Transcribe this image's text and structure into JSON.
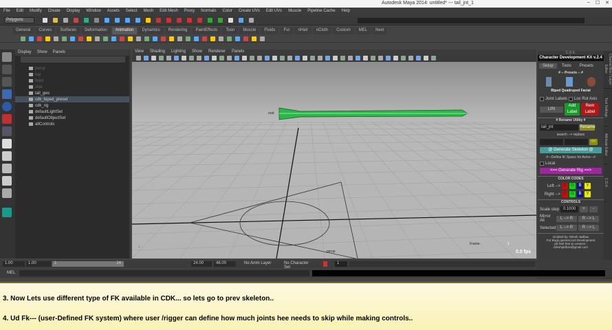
{
  "window": {
    "title": "Autodesk Maya 2014: untitled*   ---   tail_jnt_1"
  },
  "menu": [
    "File",
    "Edit",
    "Modify",
    "Create",
    "Display",
    "Window",
    "Assets",
    "Select",
    "Mesh",
    "Edit Mesh",
    "Proxy",
    "Normals",
    "Color",
    "Create UVs",
    "Edit UVs",
    "Muscle",
    "Pipeline Cache",
    "Help"
  ],
  "status": {
    "mode": "Polygons"
  },
  "shelf_tabs": [
    "General",
    "Curves",
    "Surfaces",
    "Deformation",
    "Animation",
    "Dynamics",
    "Rendering",
    "PaintEffects",
    "Toon",
    "Muscle",
    "Fluids",
    "Fur",
    "nHair",
    "nCloth",
    "Custom",
    "MEL",
    "Next"
  ],
  "shelf_active": "Animation",
  "outliner": {
    "menu": [
      "Display",
      "Show",
      "Panels"
    ],
    "items": [
      {
        "label": "persp",
        "dim": true
      },
      {
        "label": "top",
        "dim": true
      },
      {
        "label": "front",
        "dim": true
      },
      {
        "label": "side",
        "dim": true
      },
      {
        "label": "tail_geo"
      },
      {
        "label": "cdk_biped_preset",
        "selected": true
      },
      {
        "label": "cdk_rig"
      },
      {
        "label": "defaultLightSet"
      },
      {
        "label": "defaultObjectSet"
      },
      {
        "label": "allControls"
      }
    ]
  },
  "viewport": {
    "menu": [
      "View",
      "Shading",
      "Lighting",
      "Show",
      "Renderer",
      "Panels"
    ],
    "camera_label": "persp",
    "frame_label": "Frame:",
    "frame_value": "1",
    "fps": "0.0 fps",
    "joint_label": "root"
  },
  "cdk": {
    "window_title": "C.D.K.",
    "title": "Character Development Kit v.2.4",
    "tabs": [
      "Setup",
      "Tools",
      "Presets"
    ],
    "presets_header": "# -- Presets -- #",
    "preset_labels": "Biped Quadruped Facial",
    "joint_labels": "Joint Labels",
    "loc_rot_axis": "Loc Rot Axis",
    "side_select": "LtRt",
    "add_label": "Add Label",
    "rem_label": "Rem Label",
    "rename_header": "# Rename Utility #",
    "rename_value": "tail_jnt",
    "rename_btn": "Rename",
    "search_replace": "search --> replace",
    "swap_btn": "<<",
    "generate_skeleton": "@ Generate Skeleton @",
    "ik_space": "#---Define IK Space for Arms---#",
    "local": "Local",
    "generate_rig": "<== Generate Rig ==>",
    "color_codes": "COLOR CODES",
    "left": "Left -->",
    "right": "Right -->",
    "colors": [
      "R",
      "G",
      "B",
      "Y"
    ],
    "color_hex": [
      "#e00000",
      "#18d018",
      "#101090",
      "#e8e800"
    ],
    "controls": "CONTROLS",
    "scale_step": "Scale step",
    "scale_value": "0.1000",
    "plus": "+",
    "minus": "-",
    "mirror_all": "Mirror All",
    "selected": "Selected",
    "l_to_r": "L --> R",
    "r_to_l": "R --> L",
    "credits": [
      "scripted by: Nilesh Jadhav",
      "For Bugs,queries,tool Development",
      "plz feel free  to connect :",
      "nileshjadhav@gmail.com"
    ]
  },
  "side_tabs": [
    "Channel Box / Layer Editor",
    "Tool Settings",
    "Attribute Editor",
    "C.D.K."
  ],
  "range": {
    "start": "1.00",
    "start2": "1.00",
    "slider_start": "1",
    "slider_end": "24",
    "end": "24.00",
    "end2": "48.00",
    "anim_layer": "No Anim Layer",
    "char_set": "No Character Set",
    "current": "1"
  },
  "cmd": {
    "label": "MEL"
  },
  "notes": {
    "line1": "3. Now Lets use different type of FK available in CDK... so lets go to prev skeleton..",
    "line2": "4. Ud Fk--- (user-Defined FK system)  where user /rigger can define how much joints hee needs to skip while making controls.."
  }
}
